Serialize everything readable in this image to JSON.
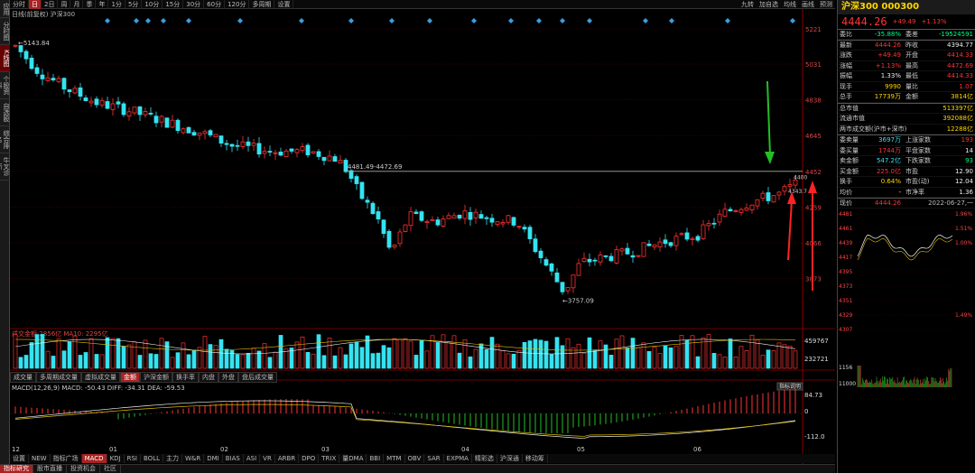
{
  "left_tabs": [
    {
      "label": "应用",
      "active": false
    },
    {
      "label": "分时图",
      "active": false
    },
    {
      "label": "K线图",
      "active": true
    },
    {
      "label": "个股资料",
      "active": false
    },
    {
      "label": "自选股",
      "active": false
    },
    {
      "label": "综合排名",
      "active": false
    },
    {
      "label": "牛叉诊断",
      "active": false
    }
  ],
  "period_tabs": [
    "分时",
    "日",
    "2日",
    "周",
    "月",
    "季",
    "年",
    "1分",
    "5分",
    "10分",
    "15分",
    "30分",
    "60分",
    "120分",
    "多周期",
    "设置"
  ],
  "period_selected": "日",
  "top_right": [
    "九转",
    "加自选",
    "均线",
    "画线",
    "预测"
  ],
  "stock_line": "日线(前复权) 沪深300",
  "indicator_btn": "指标说明",
  "price_axis": [
    "5221",
    "5031",
    "4838",
    "4645",
    "4452",
    "4259",
    "4066",
    "3873"
  ],
  "vol_axis": [
    "459767",
    "232721"
  ],
  "macd_axis": [
    "84.73",
    "0",
    "-112.0"
  ],
  "month_labels": [
    "12",
    "01",
    "02",
    "03",
    "04",
    "05",
    "06"
  ],
  "annotations": {
    "high": "5143.84",
    "low": "3757.09",
    "range": "4481.49-4472.69",
    "pt": "4400",
    "pt2": "4343.7"
  },
  "vol_legend": {
    "label": "成交金额:",
    "v1": "2856亿",
    "ma": "MA10: 2295亿"
  },
  "macd_legend": {
    "label": "MACD(12,26,9)",
    "macd": "MACD: -50.43",
    "diff": "DIFF: -34.31",
    "dea": "DEA: -59.53"
  },
  "sub_tabs": [
    "成交量",
    "多周期成交量",
    "虚拟成交量",
    "金额",
    "沪深金额",
    "换手率",
    "内盘",
    "外盘",
    "盘后成交量"
  ],
  "sub_selected": "金额",
  "ind_tabs": [
    "设置",
    "NEW",
    "指标广场",
    "MACD",
    "KDJ",
    "RSI",
    "BOLL",
    "主力",
    "W&R",
    "DMI",
    "BIAS",
    "ASI",
    "VR",
    "ARBR",
    "DPO",
    "TRIX",
    "量DMA",
    "BBI",
    "MTM",
    "OBV",
    "SAR",
    "EXPMA",
    "精彩选",
    "沪深通",
    "移动筹"
  ],
  "ind_selected": "MACD",
  "bottom_tabs": [
    "指标研究",
    "股市直播",
    "投资机会",
    "社区"
  ],
  "bottom_selected": "指标研究",
  "right": {
    "title": "沪深300 000300",
    "price": "4444.26",
    "change": "+49.49",
    "pct": "+1.13%",
    "weibi": {
      "l": "委比",
      "v": "-35.88%",
      "l2": "委差",
      "v2": "-19524591"
    },
    "rows": [
      {
        "l": "最新",
        "v": "4444.26",
        "vc": "red",
        "l2": "昨收",
        "v2": "4394.77",
        "v2c": "wht"
      },
      {
        "l": "涨跌",
        "v": "+49.49",
        "vc": "red",
        "l2": "开盘",
        "v2": "4414.33",
        "v2c": "red"
      },
      {
        "l": "涨幅",
        "v": "+1.13%",
        "vc": "red",
        "l2": "最高",
        "v2": "4472.69",
        "v2c": "red"
      },
      {
        "l": "振幅",
        "v": "1.33%",
        "vc": "wht",
        "l2": "最低",
        "v2": "4414.33",
        "v2c": "red"
      },
      {
        "l": "现手",
        "v": "9990",
        "vc": "yel",
        "l2": "量比",
        "v2": "1.07",
        "v2c": "red"
      },
      {
        "l": "总手",
        "v": "17739万",
        "vc": "yel",
        "l2": "金额",
        "v2": "3814亿",
        "v2c": "yel"
      }
    ],
    "rows2": [
      {
        "l": "总市值",
        "v2": "513397亿",
        "v2c": "yel"
      },
      {
        "l": "流通市值",
        "v2": "392088亿",
        "v2c": "yel"
      },
      {
        "l": "两市成交额(沪市+深市)",
        "v2": "12288亿",
        "v2c": "yel"
      }
    ],
    "rows3": [
      {
        "l": "委卖量",
        "v": "3697万",
        "vc": "cy",
        "l2": "上涨家数",
        "v2": "193",
        "v2c": "red"
      },
      {
        "l": "委买量",
        "v": "1744万",
        "vc": "red",
        "l2": "平盘家数",
        "v2": "14",
        "v2c": "wht"
      },
      {
        "l": "卖金额",
        "v": "547.2亿",
        "vc": "cy",
        "l2": "下跌家数",
        "v2": "93",
        "v2c": "grn"
      },
      {
        "l": "买金额",
        "v": "225.0亿",
        "vc": "red",
        "l2": "市盈",
        "v2": "12.90",
        "v2c": "wht"
      },
      {
        "l": "换手",
        "v": "0.64%",
        "vc": "yel",
        "l2": "市盈(动)",
        "v2": "12.04",
        "v2c": "wht"
      },
      {
        "l": "均价",
        "v": "-",
        "vc": "wht",
        "l2": "市净率",
        "v2": "1.36",
        "v2c": "wht"
      }
    ],
    "now": {
      "l": "现价",
      "v": "4444.26",
      "date": "2022-06-27,一"
    },
    "mini_axis_left": [
      "4481",
      "4461",
      "4439",
      "4417",
      "4395",
      "4373",
      "4351",
      "4329",
      "4307",
      "1156",
      "11000"
    ],
    "mini_axis_right": [
      "1.96%",
      "1.51%",
      "1.00%",
      "",
      "",
      "",
      "",
      "1.49%",
      ""
    ]
  }
}
